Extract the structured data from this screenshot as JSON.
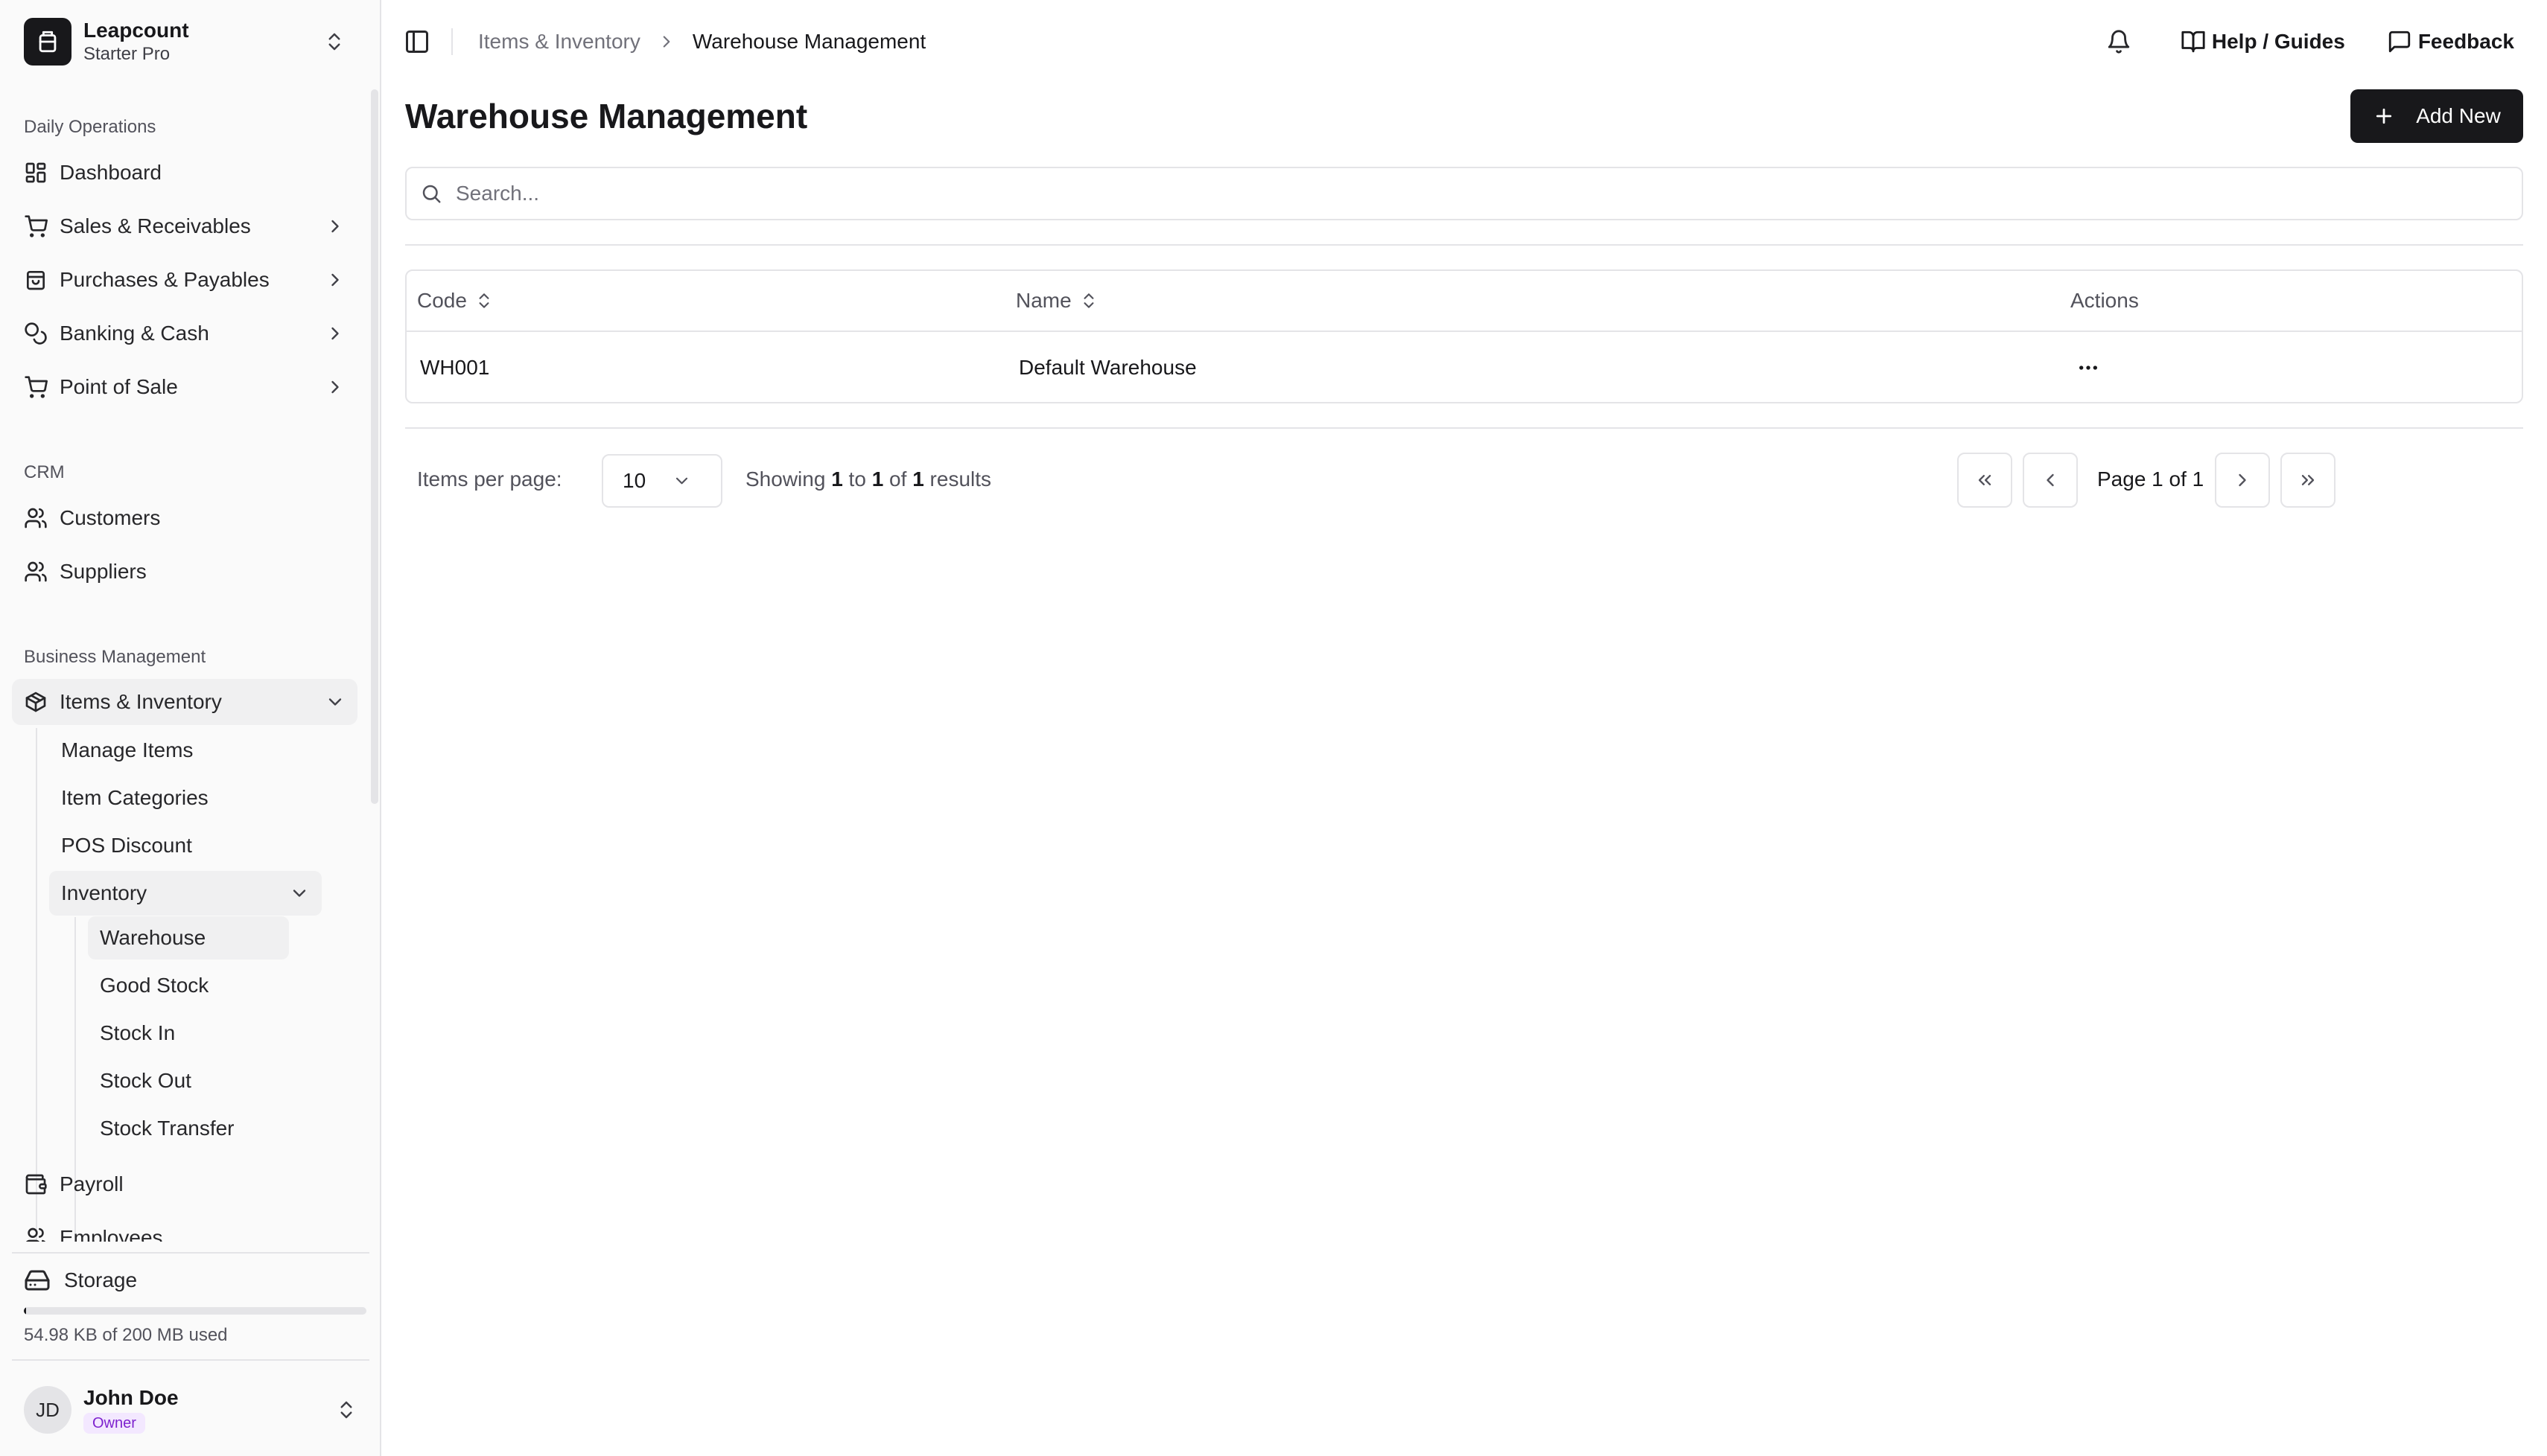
{
  "team": {
    "name": "Leapcount",
    "plan": "Starter Pro"
  },
  "sidebar": {
    "groups": [
      {
        "label": "Daily Operations"
      },
      {
        "label": "CRM"
      },
      {
        "label": "Business Management"
      }
    ],
    "daily": [
      {
        "label": "Dashboard",
        "icon": "dashboard-icon"
      },
      {
        "label": "Sales & Receivables",
        "icon": "cart-icon"
      },
      {
        "label": "Purchases & Payables",
        "icon": "shopping-bag-icon"
      },
      {
        "label": "Banking & Cash",
        "icon": "coins-icon"
      },
      {
        "label": "Point of Sale",
        "icon": "cart-icon"
      }
    ],
    "crm": [
      {
        "label": "Customers",
        "icon": "users-icon"
      },
      {
        "label": "Suppliers",
        "icon": "users-icon"
      }
    ],
    "business": {
      "items_inventory": "Items & Inventory",
      "sub": [
        "Manage Items",
        "Item Categories",
        "POS Discount"
      ],
      "inventory": "Inventory",
      "inventory_sub": [
        "Warehouse",
        "Good Stock",
        "Stock In",
        "Stock Out",
        "Stock Transfer"
      ],
      "payroll": "Payroll",
      "employees": "Employees"
    },
    "storage": {
      "label": "Storage",
      "used_text": "54.98 KB of 200 MB used",
      "used_fraction": 0.0003
    },
    "user": {
      "initials": "JD",
      "name": "John Doe",
      "role": "Owner"
    }
  },
  "topbar": {
    "breadcrumb": [
      "Items & Inventory",
      "Warehouse Management"
    ],
    "help": "Help / Guides",
    "feedback": "Feedback"
  },
  "page": {
    "title": "Warehouse Management",
    "add_button": "Add New",
    "search_placeholder": "Search..."
  },
  "table": {
    "columns": [
      "Code",
      "Name",
      "Actions"
    ],
    "rows": [
      {
        "code": "WH001",
        "name": "Default Warehouse"
      }
    ]
  },
  "pagination": {
    "items_per_page_label": "Items per page:",
    "items_per_page": "10",
    "showing_prefix": "Showing",
    "from": "1",
    "to_word": "to",
    "to": "1",
    "of_word": "of",
    "total": "1",
    "results_word": "results",
    "page_text": "Page 1 of 1"
  },
  "colors": {
    "primary": "#18181b",
    "sidebar_bg": "#fafafa",
    "border": "#e4e4e7",
    "role_badge": "#7e22ce"
  }
}
